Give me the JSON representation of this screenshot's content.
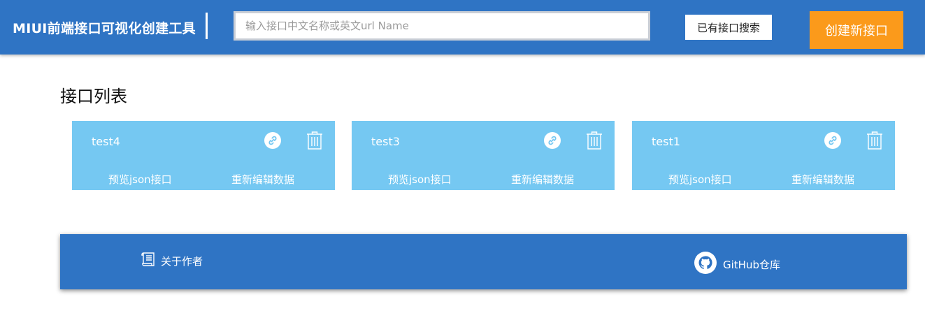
{
  "header": {
    "brand": "MIUI前端接口可视化创建工具",
    "search_placeholder": "输入接口中文名称或英文url Name",
    "search_button": "已有接口搜索",
    "create_button": "创建新接口",
    "colors": {
      "bar": "#2f74c4",
      "create": "#fb9a1b"
    }
  },
  "main": {
    "title": "接口列表",
    "cards": [
      {
        "name": "test4",
        "preview_label": "预览json接口",
        "edit_label": "重新编辑数据",
        "icons": [
          "link-icon",
          "trash-icon"
        ]
      },
      {
        "name": "test3",
        "preview_label": "预览json接口",
        "edit_label": "重新编辑数据",
        "icons": [
          "link-icon",
          "trash-icon"
        ]
      },
      {
        "name": "test1",
        "preview_label": "预览json接口",
        "edit_label": "重新编辑数据",
        "icons": [
          "link-icon",
          "trash-icon"
        ]
      }
    ],
    "card_color": "#75c8f2"
  },
  "footer": {
    "about_label": "关于作者",
    "github_label": "GitHub仓库",
    "icons": [
      "scroll-icon",
      "github-icon"
    ]
  }
}
